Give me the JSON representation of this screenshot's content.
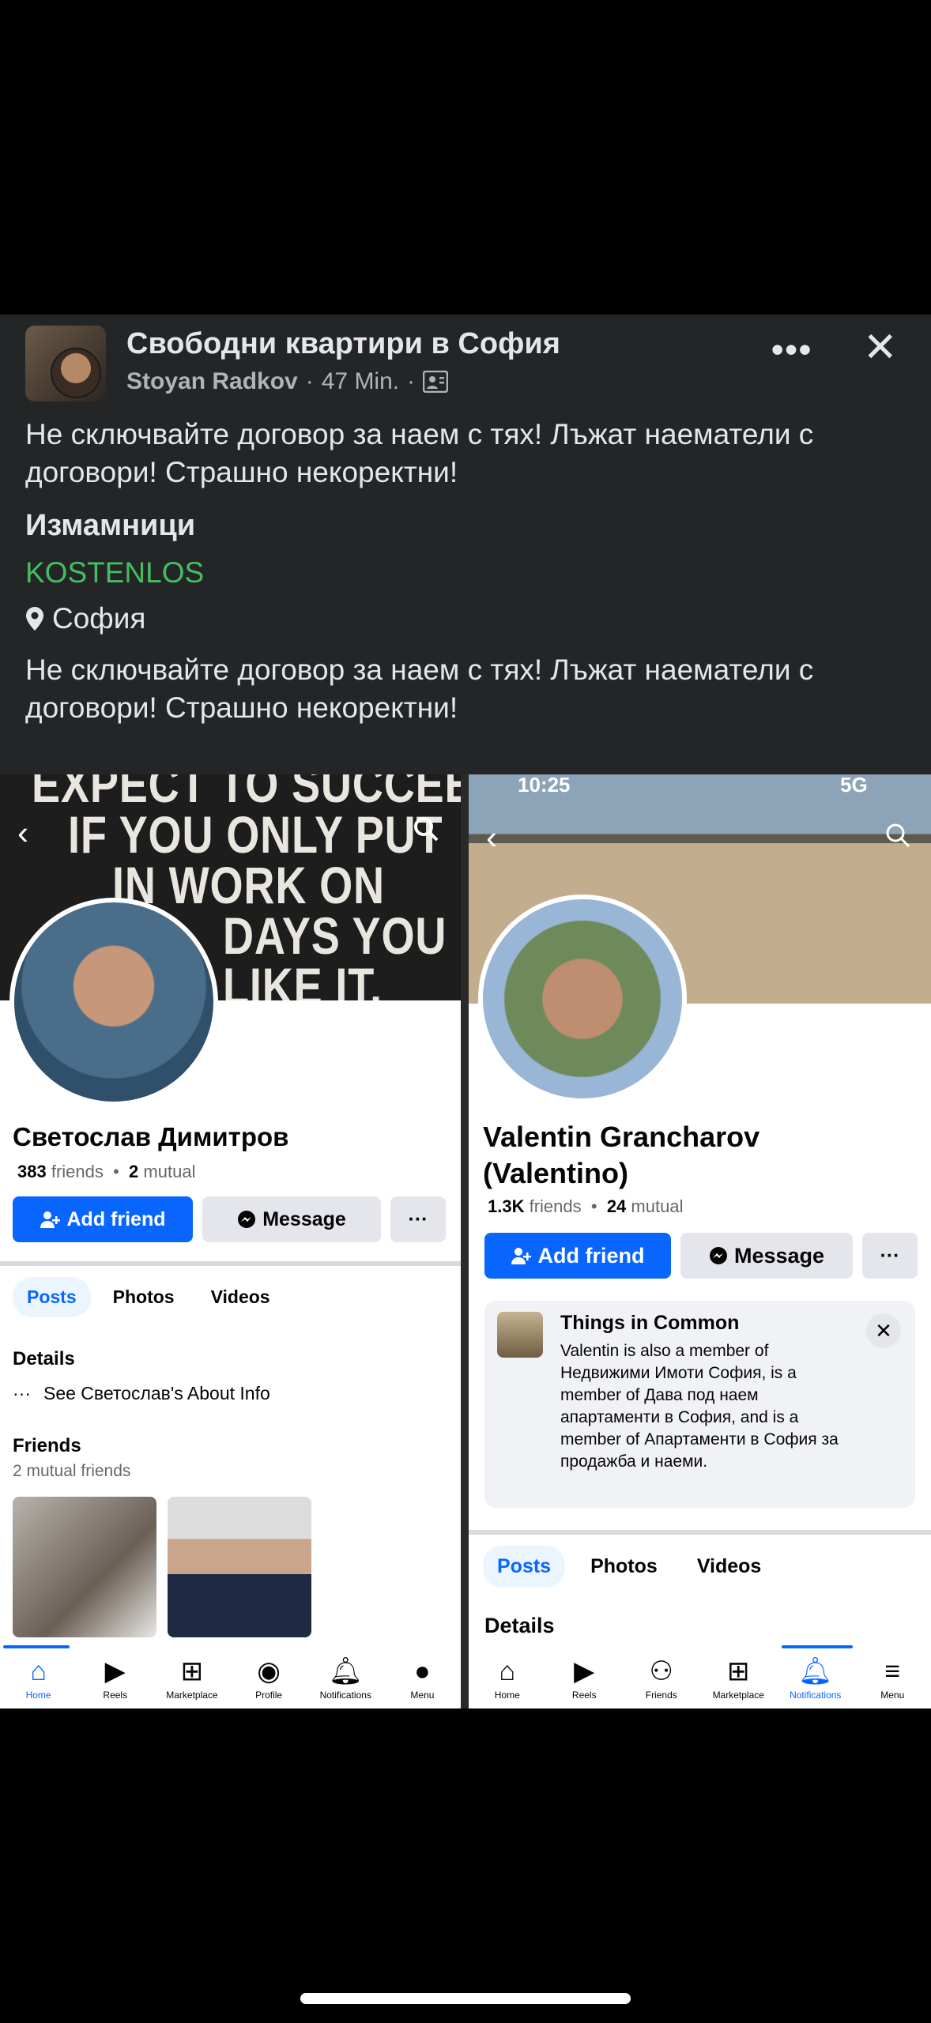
{
  "post": {
    "group": "Свободни квартири в София",
    "author": "Stoyan Radkov",
    "time": "47 Min.",
    "dot": "·",
    "more": "•••",
    "close": "✕",
    "text1": "Не сключвайте договор за наем с тях! Лъжат наематели с договори! Страшно некоректни!",
    "heading": "Измамници",
    "price": "KOSTENLOS",
    "location": "София",
    "text2": "Не сключвайте договор за наем с тях! Лъжат наематели с договори! Страшно некоректни!"
  },
  "left": {
    "cover_lines": [
      "EXPECT TO SUCCEED",
      "IF YOU ONLY PUT",
      "IN WORK ON",
      "DAYS YOU",
      "LIKE IT."
    ],
    "name": "Светослав Димитров",
    "friends_count": "383",
    "friends_label": "friends",
    "mutual_count": "2",
    "mutual_label": "mutual",
    "add_friend": "Add friend",
    "message": "Message",
    "more": "···",
    "tabs": [
      "Posts",
      "Photos",
      "Videos"
    ],
    "details_title": "Details",
    "about_dots": "···",
    "about_link": "See Светослав's About Info",
    "friends_title": "Friends",
    "friends_sub": "2 mutual friends",
    "nav": [
      "Home",
      "Reels",
      "Marketplace",
      "Profile",
      "Notifications",
      "Menu"
    ]
  },
  "right": {
    "time": "10:25",
    "signal": "5G",
    "name": "Valentin Grancharov (Valentino)",
    "friends_count": "1.3K",
    "friends_label": "friends",
    "mutual_count": "24",
    "mutual_label": "mutual",
    "add_friend": "Add friend",
    "message": "Message",
    "more": "···",
    "common_title": "Things in Common",
    "common_body": "Valentin is also a member of Недвижими Имоти София, is a member of Дава под наем апартаменти в София, and is a member of Апартаменти в София за продажба и наеми.",
    "tabs": [
      "Posts",
      "Photos",
      "Videos"
    ],
    "details_title": "Details",
    "nav": [
      "Home",
      "Reels",
      "Friends",
      "Marketplace",
      "Notifications",
      "Menu"
    ]
  }
}
